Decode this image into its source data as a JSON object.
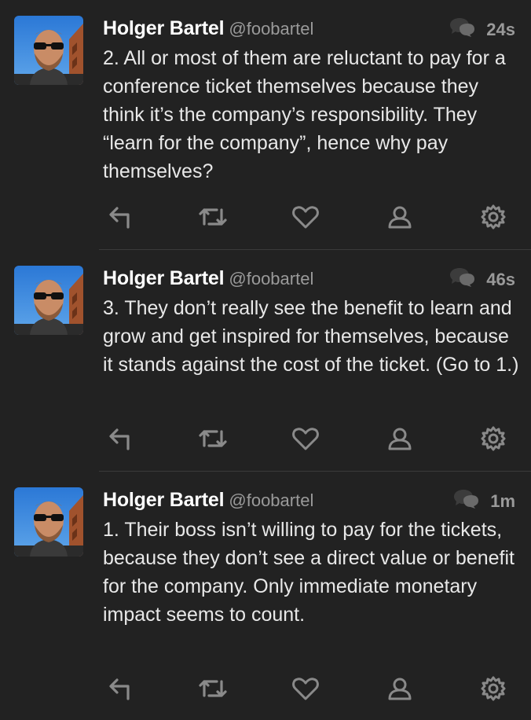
{
  "colors": {
    "background": "#222222",
    "name": "#ffffff",
    "secondary_text": "#9a9a9a",
    "body_text": "#e8e8e8",
    "icon": "#8a8a8a",
    "divider": "#3a3a3a"
  },
  "tweets": [
    {
      "name": "Holger Bartel",
      "handle": "@foobartel",
      "time": "24s",
      "text": "2. All or most of them are reluctant to pay for a conference ticket themselves because they think it’s the company’s responsibility. They “learn for the company”, hence why pay themselves?"
    },
    {
      "name": "Holger Bartel",
      "handle": "@foobartel",
      "time": "46s",
      "text": "3. They don’t really see the benefit to learn and grow and get inspired for themselves, because it stands against the cost of the ticket. (Go to 1.)"
    },
    {
      "name": "Holger Bartel",
      "handle": "@foobartel",
      "time": "1m",
      "text": "1. Their boss isn’t willing to pay for the tickets, because they don’t see a direct value or benefit for the company. Only immediate monetary impact seems to count."
    }
  ],
  "actions": [
    "reply-icon",
    "retweet-icon",
    "like-icon",
    "profile-icon",
    "gear-icon"
  ]
}
